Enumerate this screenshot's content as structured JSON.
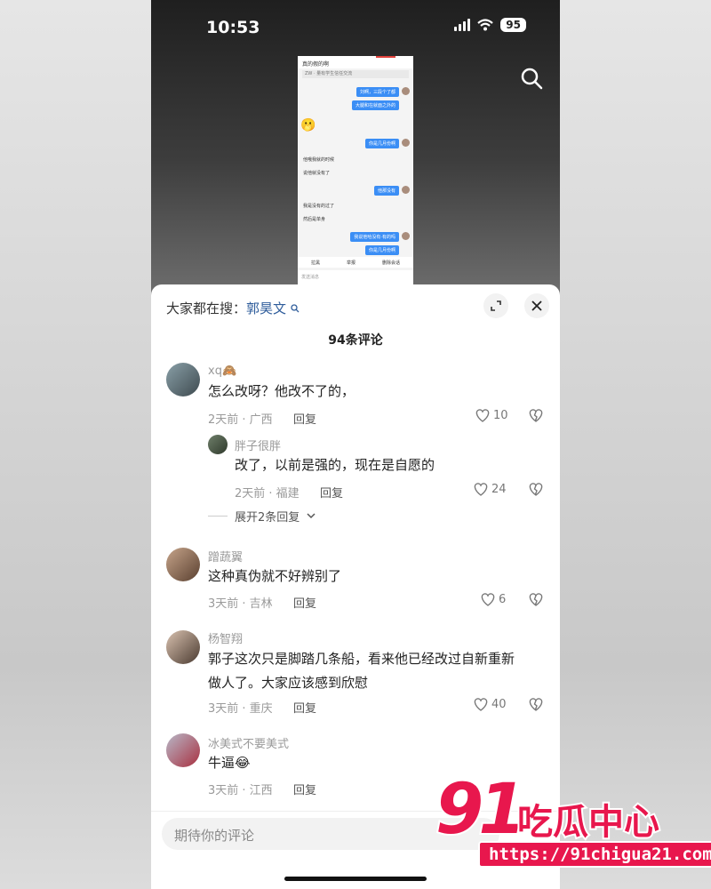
{
  "status": {
    "time": "10:53",
    "battery": "95"
  },
  "thumbnail": {
    "title": "真的假的啊",
    "subtitle": "ZW · 量有学生信任交流",
    "msgs": [
      {
        "side": "right",
        "text": "刘啊，三段个了都"
      },
      {
        "side": "right",
        "text": "大腿和在就面之外的"
      },
      {
        "side": "right",
        "text": "你是几月份啊"
      },
      {
        "side": "left",
        "text": "他哦我就的时候"
      },
      {
        "side": "left",
        "text": "说他就没有了"
      },
      {
        "side": "right",
        "text": "他那没有"
      },
      {
        "side": "left",
        "text": "我是没有的过了"
      },
      {
        "side": "left",
        "text": "然后是单身"
      },
      {
        "side": "right",
        "text": "我说他哈没有·有的吗"
      },
      {
        "side": "right",
        "text": "你是几月份啊"
      }
    ],
    "bar": [
      "拉黑",
      "举报",
      "删除会话"
    ],
    "input": "发送消息"
  },
  "header": {
    "hot_label": "大家都在搜：",
    "hot_keyword": "郭昊文",
    "count": "94条评论"
  },
  "comments": [
    {
      "user": "xq🙈",
      "text": "怎么改呀？他改不了的，",
      "meta": "2天前 · 广西",
      "reply": "回复",
      "likes": "10"
    },
    {
      "user": "胖子很胖",
      "text": "改了，以前是强的，现在是自愿的",
      "meta": "2天前 · 福建",
      "reply": "回复",
      "likes": "24"
    },
    {
      "user": "蹭蔬翼",
      "text": "这种真伪就不好辨别了",
      "meta": "3天前 · 吉林",
      "reply": "回复",
      "likes": "6"
    },
    {
      "user": "杨智翔",
      "text_lines": [
        "郭子这次只是脚踏几条船，看来他已经改过自新重新",
        "做人了。大家应该感到欣慰"
      ],
      "meta": "3天前 · 重庆",
      "reply": "回复",
      "likes": "40"
    },
    {
      "user": "冰美式不要美式",
      "text": "牛逼😂",
      "meta": "3天前 · 江西",
      "reply": "回复",
      "likes": ""
    }
  ],
  "expand_replies": "展开2条回复",
  "input_placeholder": "期待你的评论",
  "watermark": {
    "number": "91",
    "brand": "吃瓜中心",
    "url": "https://91chigua21.com"
  },
  "colors": {
    "keyword": "#2f5d9b",
    "watermark": "#e8174d",
    "bubble": "#3b8ef5"
  }
}
